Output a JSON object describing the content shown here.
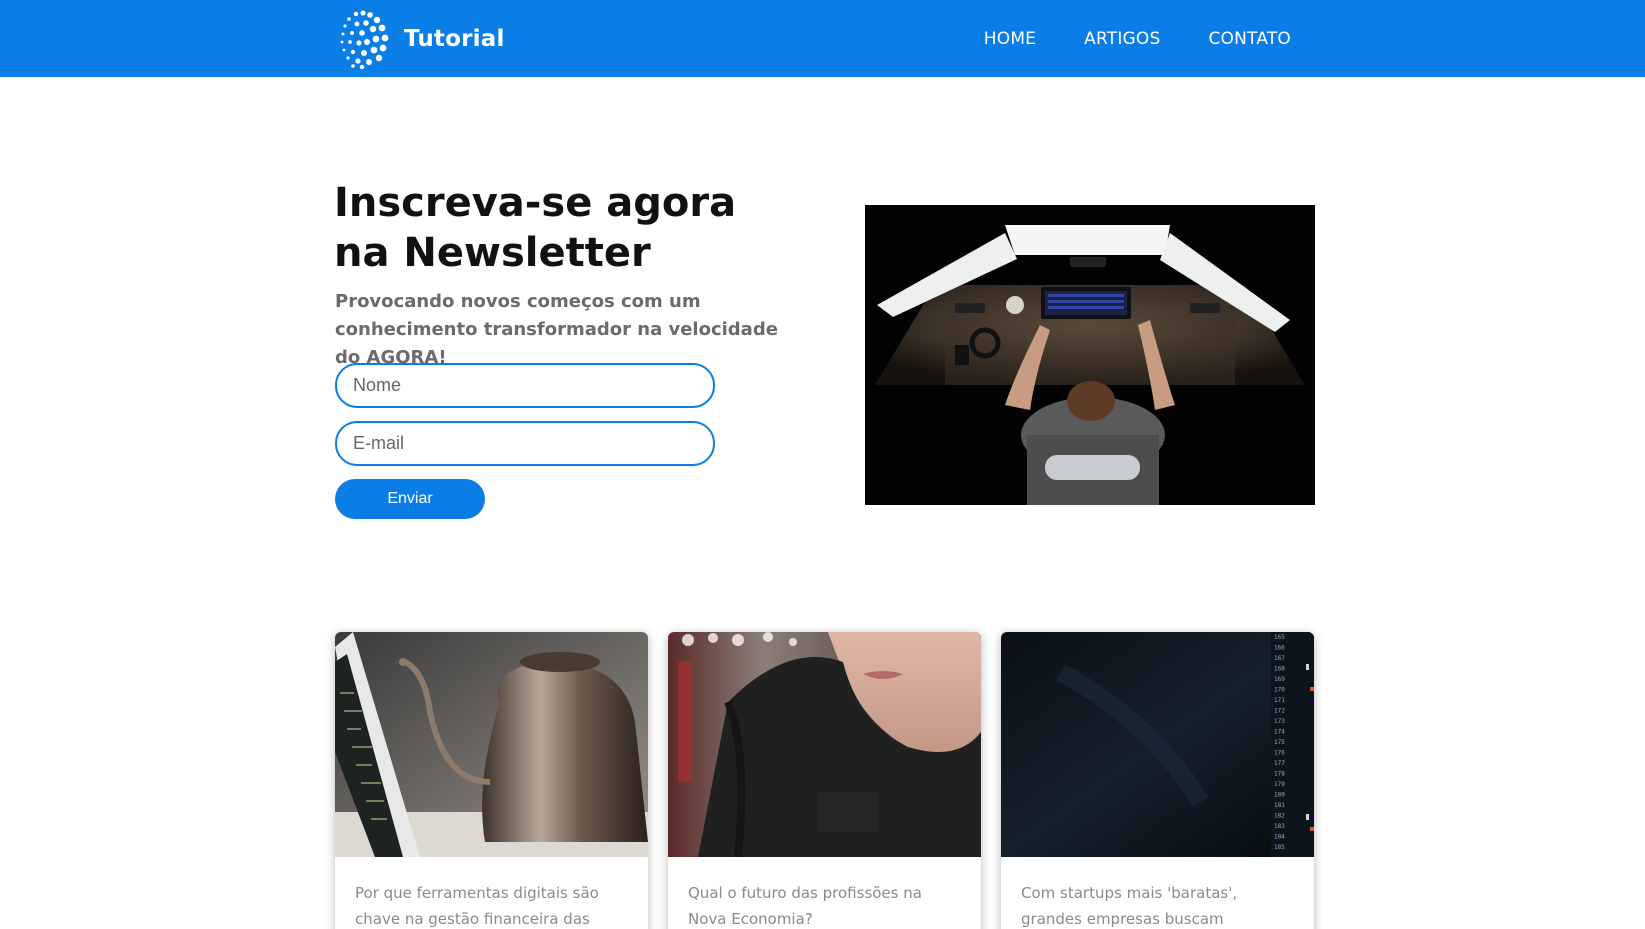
{
  "header": {
    "brand": "Tutorial",
    "nav": [
      {
        "label": "HOME"
      },
      {
        "label": "ARTIGOS"
      },
      {
        "label": "CONTATO"
      }
    ]
  },
  "hero": {
    "title_line1": "Inscreva-se agora",
    "title_line2": "na Newsletter",
    "subtitle": "Provocando novos começos com um conhecimento transformador na velocidade do AGORA!",
    "name_placeholder": "Nome",
    "email_placeholder": "E-mail",
    "submit_label": "Enviar"
  },
  "articles": [
    {
      "title": "Por que ferramentas digitais são chave na gestão financeira das startups"
    },
    {
      "title": "Qual o futuro das profissões na Nova Economia?"
    },
    {
      "title": "Com startups mais 'baratas', grandes empresas buscam aquisições"
    }
  ],
  "code_line_numbers": [
    "165",
    "166",
    "167",
    "168",
    "169",
    "170",
    "171",
    "172",
    "173",
    "174",
    "175",
    "176",
    "177",
    "178",
    "179",
    "180",
    "181",
    "182",
    "183",
    "184",
    "185"
  ],
  "colors": {
    "brand_blue": "#0a7ee6",
    "heading": "#111111",
    "subtitle": "#6b6b6b",
    "card_text": "#8a8a8a"
  }
}
